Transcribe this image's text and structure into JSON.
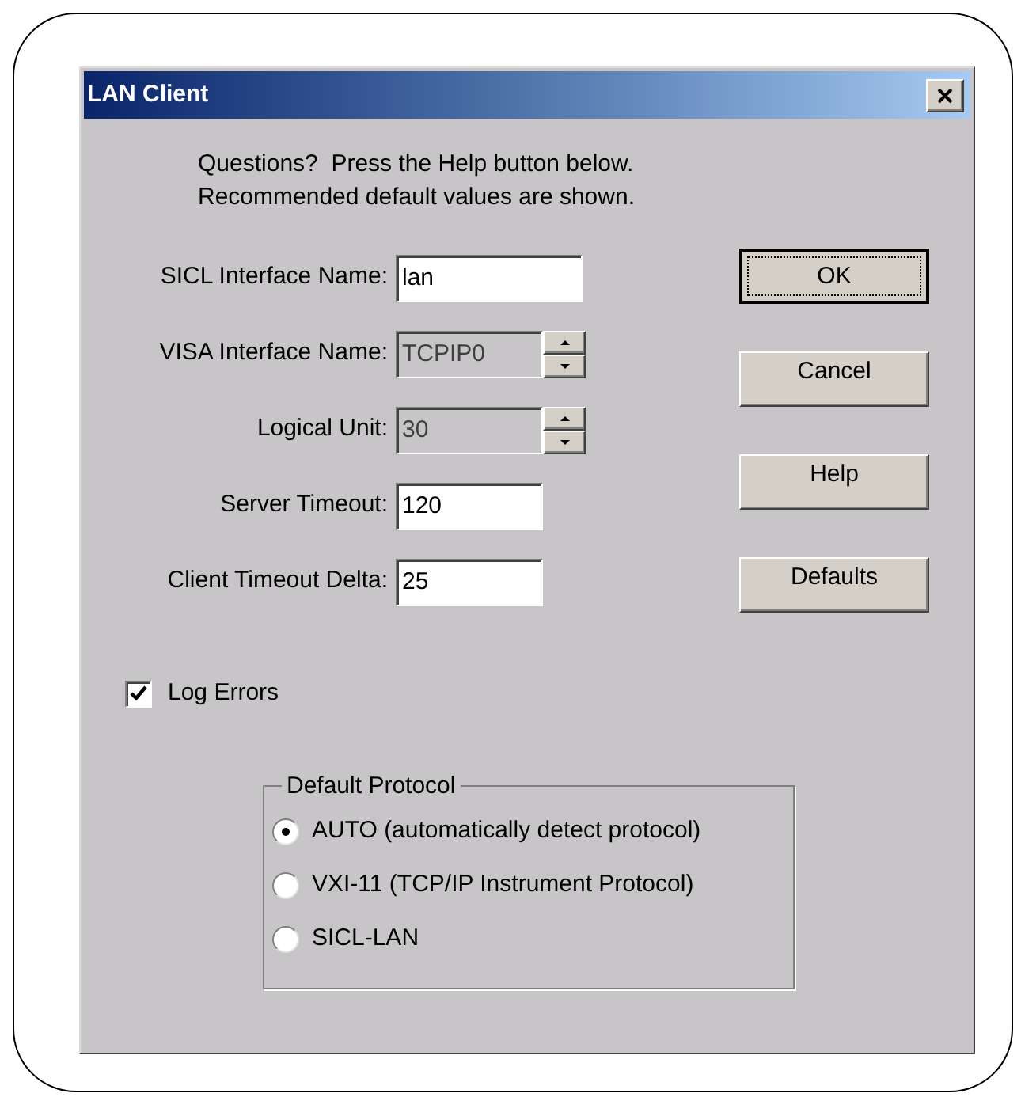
{
  "window": {
    "title": "LAN Client"
  },
  "intro": [
    "Questions?  Press the Help button below.",
    "Recommended default values are shown."
  ],
  "fields": [
    {
      "label": "SICL Interface Name:",
      "value": "lan",
      "kind": "text",
      "disabled": false
    },
    {
      "label": "VISA Interface Name:",
      "value": "TCPIP0",
      "kind": "spin",
      "disabled": true
    },
    {
      "label": "Logical Unit:",
      "value": "30",
      "kind": "spin",
      "disabled": true
    },
    {
      "label": "Server Timeout:",
      "value": "120",
      "kind": "text",
      "disabled": false
    },
    {
      "label": "Client Timeout Delta:",
      "value": "25",
      "kind": "text",
      "disabled": false
    }
  ],
  "buttons": [
    {
      "label": "OK",
      "focused": true
    },
    {
      "label": "Cancel",
      "focused": false
    },
    {
      "label": "Help",
      "focused": false
    },
    {
      "label": "Defaults",
      "focused": false
    }
  ],
  "log_errors": {
    "label": "Log Errors",
    "checked": true
  },
  "protocol": {
    "title": "Default Protocol",
    "options": [
      {
        "label": "AUTO (automatically detect protocol)",
        "selected": true
      },
      {
        "label": "VXI-11 (TCP/IP Instrument Protocol)",
        "selected": false
      },
      {
        "label": "SICL-LAN",
        "selected": false
      }
    ]
  }
}
